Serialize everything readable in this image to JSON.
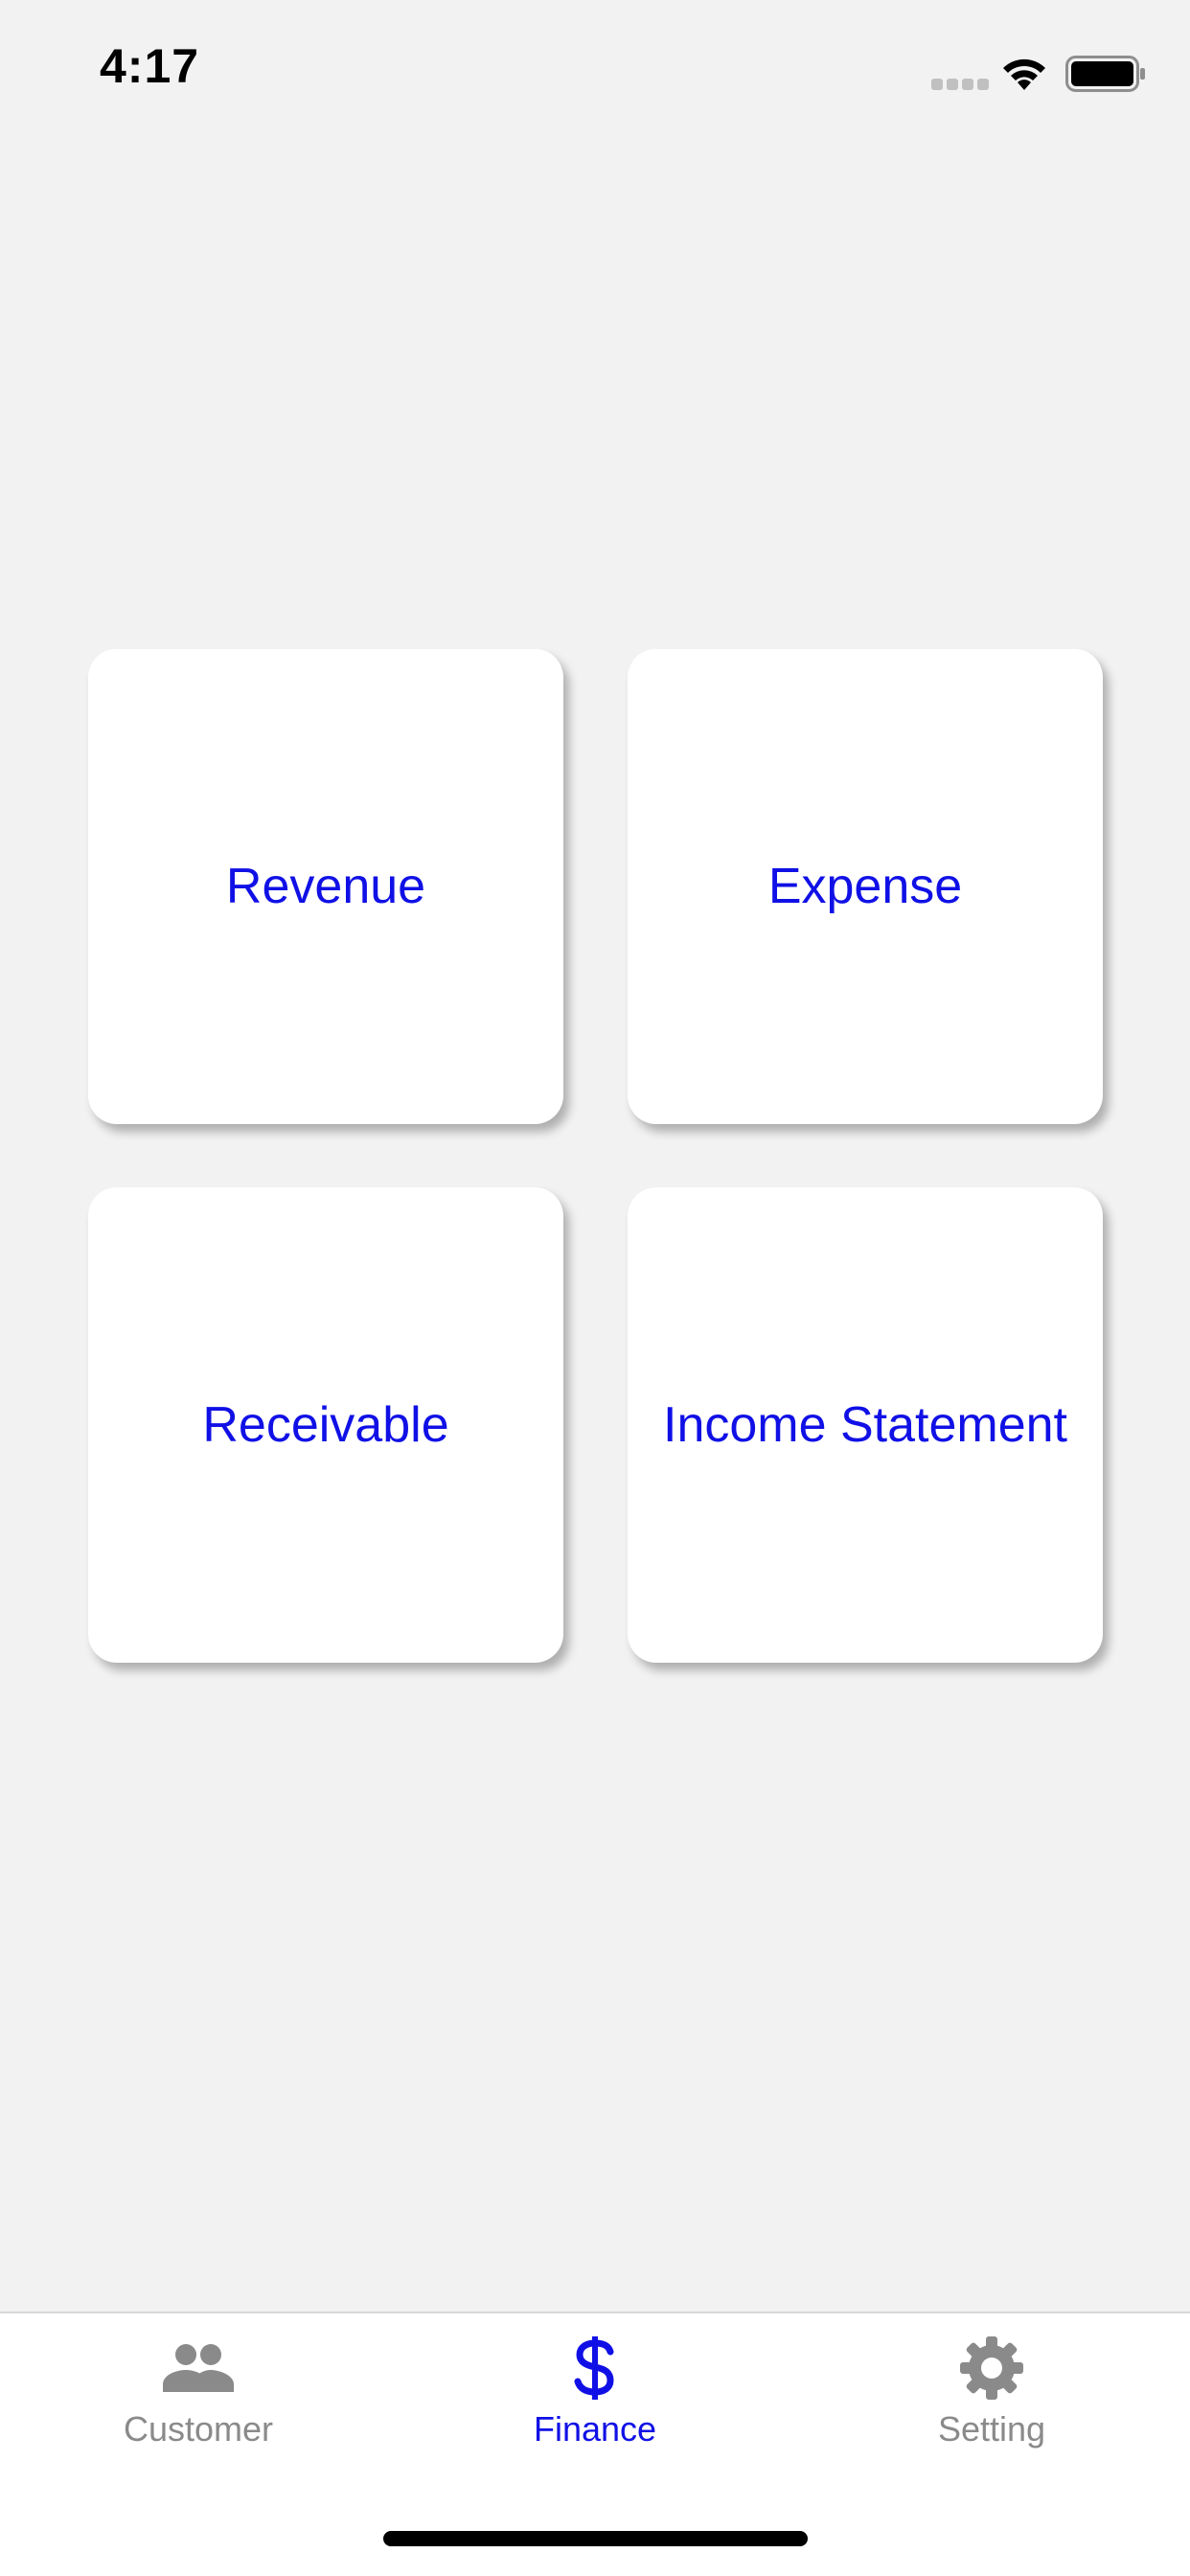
{
  "status_bar": {
    "time": "4:17"
  },
  "cards": {
    "revenue": "Revenue",
    "expense": "Expense",
    "receivable": "Receivable",
    "income_statement": "Income Statement"
  },
  "tab_bar": {
    "tabs": [
      {
        "label": "Customer",
        "icon": "people-icon",
        "active": false
      },
      {
        "label": "Finance",
        "icon": "dollar-icon",
        "active": true
      },
      {
        "label": "Setting",
        "icon": "gear-icon",
        "active": false
      }
    ]
  },
  "colors": {
    "accent": "#1010e6",
    "inactive": "#8a8a8a",
    "background": "#f2f2f2"
  }
}
